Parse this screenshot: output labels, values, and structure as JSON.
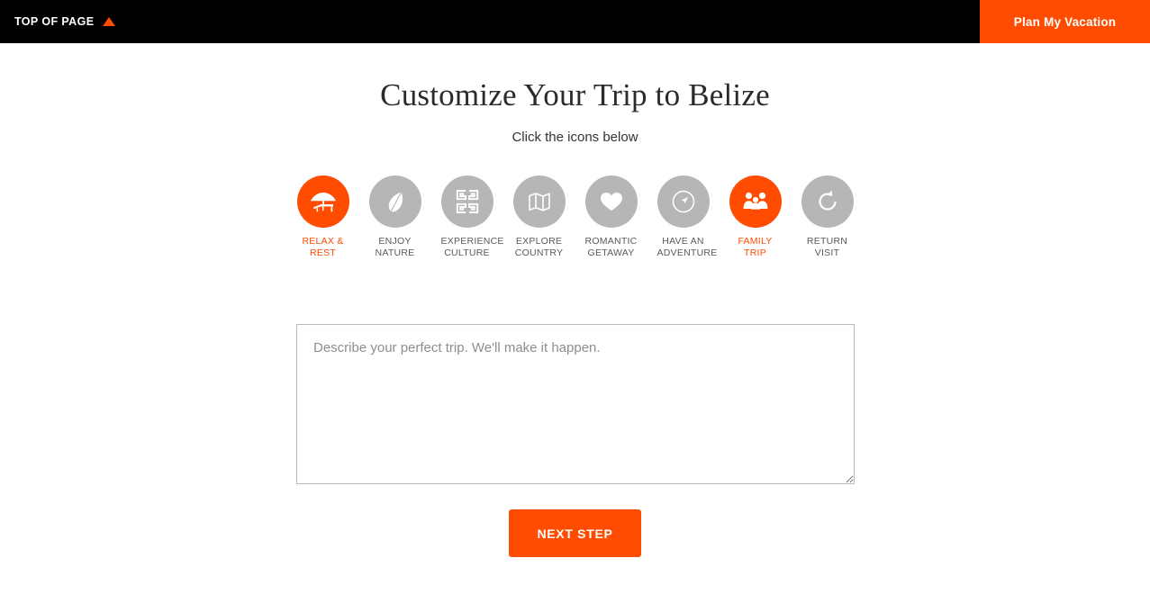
{
  "topbar": {
    "top_of_page_label": "TOP OF PAGE",
    "top_of_page_icon": "up-triangle-icon",
    "plan_button_label": "Plan My Vacation",
    "background_color": "#000000",
    "accent_color": "#FF4C00"
  },
  "main": {
    "title": "Customize Your Trip to Belize",
    "subtitle": "Click the icons below",
    "icon_inactive_color": "#B6B6B6",
    "icon_active_color": "#FF4C00",
    "icons": [
      {
        "label": "RELAX &\nREST",
        "icon": "beach-umbrella-lounger-icon",
        "selected": true
      },
      {
        "label": "ENJOY\nNATURE",
        "icon": "leaf-icon",
        "selected": false
      },
      {
        "label": "EXPERIENCE\nCULTURE",
        "icon": "mayan-fret-pattern-icon",
        "selected": false
      },
      {
        "label": "EXPLORE\nCOUNTRY",
        "icon": "folded-map-icon",
        "selected": false
      },
      {
        "label": "ROMANTIC\nGETAWAY",
        "icon": "heart-icon",
        "selected": false
      },
      {
        "label": "HAVE AN\nADVENTURE",
        "icon": "compass-icon",
        "selected": false
      },
      {
        "label": "FAMILY\nTRIP",
        "icon": "family-group-icon",
        "selected": true
      },
      {
        "label": "RETURN\nVISIT",
        "icon": "refresh-arrow-icon",
        "selected": false
      }
    ],
    "textarea_placeholder": "Describe your perfect trip. We'll make it happen.",
    "textarea_value": "",
    "next_button_label": "NEXT STEP"
  }
}
